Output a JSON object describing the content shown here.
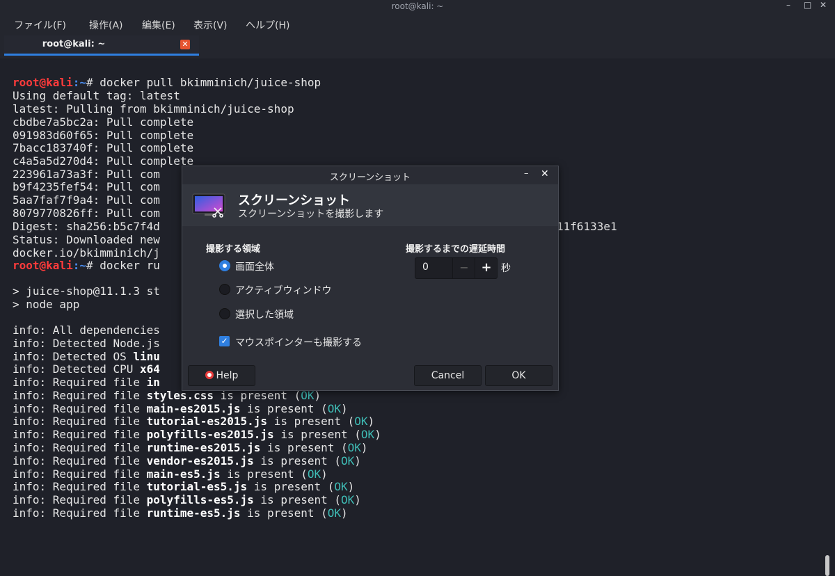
{
  "window": {
    "title": "root@kali: ~",
    "minimize": "–",
    "maximize": "□",
    "close": "✕"
  },
  "menu": [
    "ファイル(F)",
    "操作(A)",
    "編集(E)",
    "表示(V)",
    "ヘルプ(H)"
  ],
  "tab": {
    "label": "root@kali: ~",
    "close": "✕"
  },
  "terminal": {
    "prompt_user": "root@kali",
    "prompt_path": ":~",
    "prompt_symbol": "# ",
    "cmd1": "docker pull bkimminich/juice-shop",
    "lines_plain": [
      "Using default tag: latest",
      "latest: Pulling from bkimminich/juice-shop",
      "cbdbe7a5bc2a: Pull complete",
      "091983d60f65: Pull complete",
      "7bacc183740f: Pull complete",
      "c4a5a5d270d4: Pull complete",
      "223961a73a3f: Pull com",
      "b9f4235fef54: Pull com",
      "5aa7faf7f9a4: Pull com",
      "8079770826ff: Pull com",
      "Digest: sha256:b5c7f4d",
      "Status: Downloaded new",
      "docker.io/bkimminich/j"
    ],
    "digest_tail": "11f6133e1",
    "cmd2": "docker ru",
    "start_lines": [
      "> juice-shop@11.1.3 st",
      "> node app"
    ],
    "info_lines": [
      "info: All dependencies",
      "info: Detected Node.js",
      "info: Detected OS ",
      "info: Detected CPU "
    ],
    "info_bold": [
      "",
      "",
      "linu",
      "x64"
    ],
    "required_prefix": "info: Required file ",
    "required_first": "in",
    "required_files": [
      "styles.css",
      "main-es2015.js",
      "tutorial-es2015.js",
      "polyfills-es2015.js",
      "runtime-es2015.js",
      "vendor-es2015.js",
      "main-es5.js",
      "tutorial-es5.js",
      "polyfills-es5.js",
      "runtime-es5.js"
    ],
    "present_text": " is present (",
    "ok_text": "OK",
    "close_paren": ")"
  },
  "dialog": {
    "window_title": "スクリーンショット",
    "minimize": "–",
    "close": "✕",
    "heading": "スクリーンショット",
    "subheading": "スクリーンショットを撮影します",
    "region_title": "撮影する領域",
    "region_options": [
      "画面全体",
      "アクティブウィンドウ",
      "選択した領域"
    ],
    "region_selected": 0,
    "pointer_label": "マウスポインターも撮影する",
    "pointer_checked": true,
    "delay_title": "撮影するまでの遅延時間",
    "delay_value": "0",
    "delay_minus": "−",
    "delay_plus": "+",
    "delay_unit": "秒",
    "help_label": "Help",
    "cancel_label": "Cancel",
    "ok_label": "OK"
  }
}
